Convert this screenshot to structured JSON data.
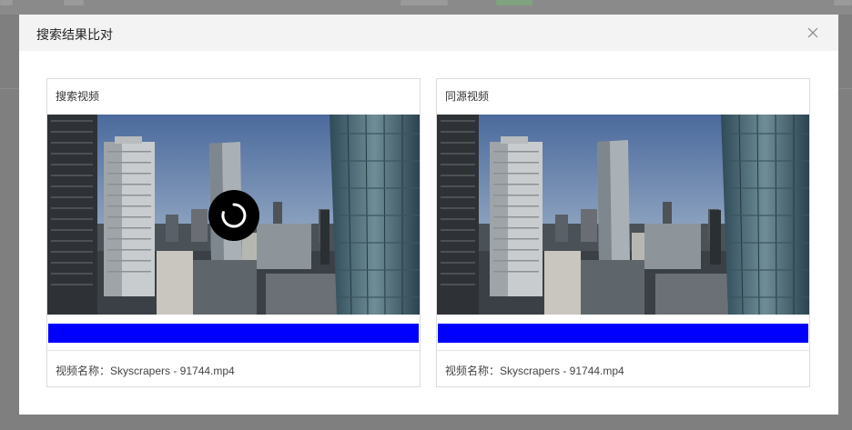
{
  "dialog": {
    "title": "搜索结果比对"
  },
  "panels": [
    {
      "title": "搜索视频",
      "caption": "视频名称：Skyscrapers - 91744.mp4",
      "progress": 1.0,
      "loading": true
    },
    {
      "title": "同源视频",
      "caption": "视频名称：Skyscrapers - 91744.mp4",
      "progress": 1.0,
      "loading": false
    }
  ],
  "colors": {
    "progress": "#0000ff",
    "sky_top": "#4f6fa0",
    "sky_bottom": "#c9c2b4",
    "header_bg": "#f3f3f3"
  },
  "icons": {
    "close": "close-icon",
    "loader": "loading-spinner-icon"
  }
}
